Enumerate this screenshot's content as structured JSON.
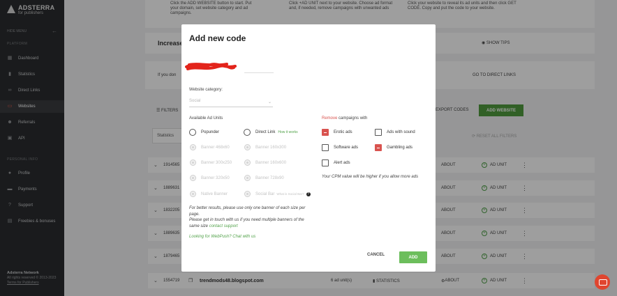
{
  "brand": {
    "name": "ADSTERRA",
    "sub": "for publishers"
  },
  "sidebar": {
    "hide_menu": "HIDE MENU",
    "platform_label": "PLATFORM",
    "items": [
      {
        "label": "Dashboard",
        "icon": "dashboard-icon"
      },
      {
        "label": "Statistics",
        "icon": "bar-chart-icon"
      },
      {
        "label": "Direct Links",
        "icon": "link-icon"
      },
      {
        "label": "Websites",
        "icon": "monitor-icon"
      },
      {
        "label": "Referrals",
        "icon": "users-icon"
      },
      {
        "label": "API",
        "icon": "code-icon"
      }
    ],
    "personal_label": "PERSONAL INFO",
    "personal_items": [
      {
        "label": "Profile",
        "icon": "person-icon"
      },
      {
        "label": "Payments",
        "icon": "card-icon"
      },
      {
        "label": "Support",
        "icon": "help-icon"
      },
      {
        "label": "Freebies & bonuses",
        "icon": "gift-icon"
      }
    ],
    "footer": {
      "title": "Adsterra Network",
      "rights": "All rights reserved © 2013-2023",
      "terms": "Terms for Publishers"
    }
  },
  "background": {
    "tips": [
      "Click the ADD WEBSITE button to start. Put your domain, set website category and ad campaigns.",
      "Click +AD UNIT next to your website. Choose ad format and, if needed, remove campaigns with unwanted ads",
      "Click your website to reveal its ad units and then click GET CODE. Copy and put the code to your website."
    ],
    "increase_title": "Increase",
    "show_tips": "SHOW TIPS",
    "if_you_dont": "If you don",
    "go_direct": "GO TO DIRECT LINKS",
    "filters": "FILTERS",
    "export": "EXPORT CODES",
    "add_website": "ADD WEBSITE",
    "statistics": "Statistics",
    "reset": "RESET ALL FILTERS",
    "rows": [
      "1914565",
      "1889631",
      "1832205",
      "1889635",
      "1879465",
      "1554719"
    ],
    "last_row": {
      "site": "trendmods48.blogspot.com",
      "units": "6 ad unit(s)",
      "stats": "STATISTICS"
    },
    "about": "ABOUT",
    "ad_unit": "AD UNIT"
  },
  "modal": {
    "title": "Add new code",
    "website_category_label": "Website category:",
    "category_value": "Social",
    "available_label": "Available Ad Units",
    "units_left": [
      {
        "label": "Popunder",
        "enabled": true
      },
      {
        "label": "Banner 468x60",
        "enabled": false
      },
      {
        "label": "Banner 300x250",
        "enabled": false
      },
      {
        "label": "Banner 320x50",
        "enabled": false
      },
      {
        "label": "Native Banner",
        "enabled": false
      }
    ],
    "units_right": [
      {
        "label": "Direct Link",
        "enabled": true
      },
      {
        "label": "Banner 160x300",
        "enabled": false
      },
      {
        "label": "Banner 160x600",
        "enabled": false
      },
      {
        "label": "Banner 728x90",
        "enabled": false
      },
      {
        "label": "Social Bar",
        "enabled": false
      }
    ],
    "how_it_works": "How it works",
    "what_is_social": "What is Social Bar?",
    "remove_word": "Remove",
    "remove_rest": " campaigns with",
    "campaigns": [
      {
        "label": "Erotic ads",
        "checked": true
      },
      {
        "label": "Ads with sound",
        "checked": false
      },
      {
        "label": "Software ads",
        "checked": false
      },
      {
        "label": "Gambling ads",
        "checked": true
      },
      {
        "label": "Alert ads",
        "checked": false
      }
    ],
    "cpm_note": "Your CPM value will be higher if you allow more ads",
    "note_1": "For better results, please use only one banner of each size per page.",
    "note_2": "Please get in touch with us if you need multiple banners of the same size",
    "contact_support": "contact support",
    "webpush": "Looking for WebPush? Chat with us",
    "cancel": "CANCEL",
    "add": "ADD"
  }
}
